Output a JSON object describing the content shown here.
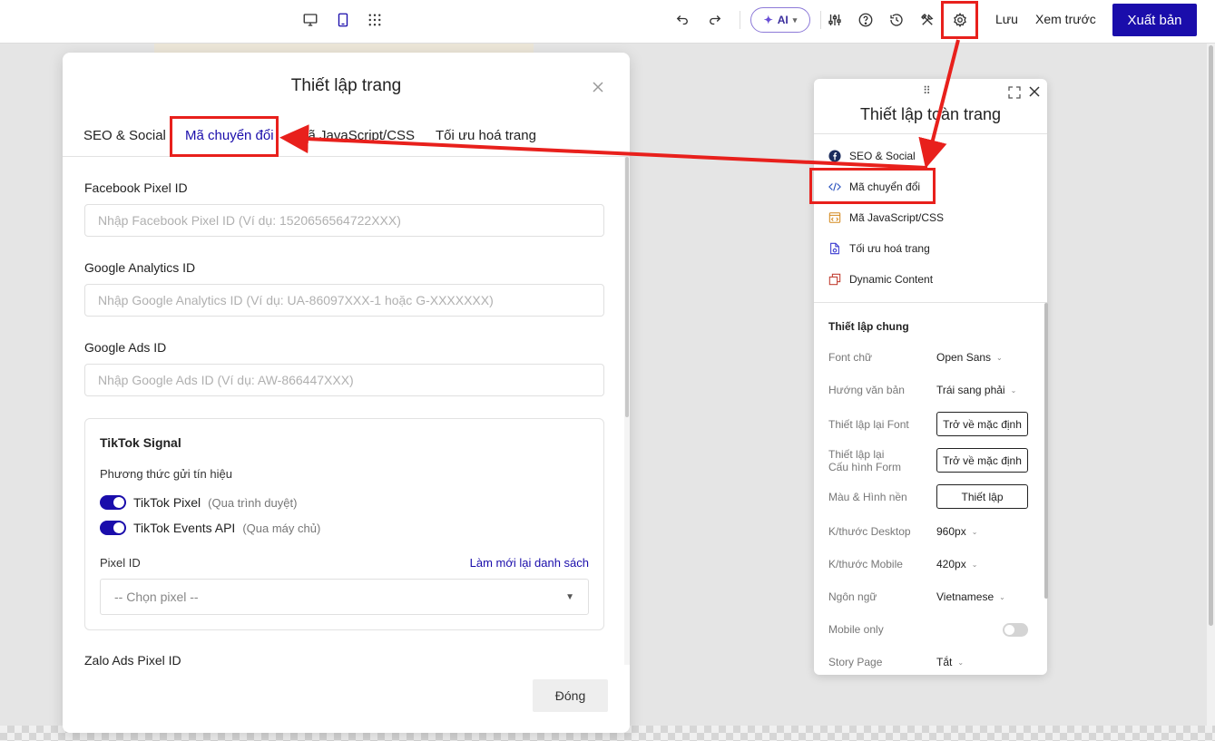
{
  "toolbar": {
    "ai_label": "AI",
    "save_label": "Lưu",
    "preview_label": "Xem trước",
    "publish_label": "Xuất bản"
  },
  "modal": {
    "title": "Thiết lập trang",
    "tabs": [
      {
        "label": "SEO & Social"
      },
      {
        "label": "Mã chuyển đổi"
      },
      {
        "label": "Mã JavaScript/CSS"
      },
      {
        "label": "Tối ưu hoá trang"
      }
    ],
    "active_tab": "Mã chuyển đổi",
    "fields": {
      "facebook": {
        "label": "Facebook Pixel ID",
        "value": "",
        "placeholder": "Nhập Facebook Pixel ID (Ví dụ: 1520656564722XXX)"
      },
      "analytics": {
        "label": "Google Analytics ID",
        "value": "",
        "placeholder": "Nhập Google Analytics ID (Ví dụ: UA-86097XXX-1 hoặc G-XXXXXXX)"
      },
      "ads": {
        "label": "Google Ads ID",
        "value": "",
        "placeholder": "Nhập Google Ads ID (Ví dụ: AW-866447XXX)"
      }
    },
    "tiktok": {
      "title": "TikTok Signal",
      "method_label": "Phương thức gửi tín hiệu",
      "pixel_toggle": {
        "label": "TikTok Pixel",
        "hint": "(Qua trình duyệt)",
        "on": true
      },
      "events_toggle": {
        "label": "TikTok Events API",
        "hint": "(Qua máy chủ)",
        "on": true
      },
      "pixel_id_label": "Pixel ID",
      "refresh_link": "Làm mới lại danh sách",
      "pixel_select_value": "-- Chọn pixel --"
    },
    "next_section_label": "Zalo Ads Pixel ID",
    "close_label": "Đóng"
  },
  "panel": {
    "title": "Thiết lập toàn trang",
    "menu": [
      {
        "label": "SEO & Social",
        "icon": "facebook-icon"
      },
      {
        "label": "Mã chuyển đổi",
        "icon": "code-icon"
      },
      {
        "label": "Mã JavaScript/CSS",
        "icon": "file-code-icon"
      },
      {
        "label": "Tối ưu hoá trang",
        "icon": "page-optimize-icon"
      },
      {
        "label": "Dynamic Content",
        "icon": "dynamic-content-icon"
      }
    ],
    "section_title": "Thiết lập chung",
    "settings": {
      "font": {
        "label": "Font chữ",
        "value": "Open Sans"
      },
      "direction": {
        "label": "Hướng văn bản",
        "value": "Trái sang phải"
      },
      "reset_font": {
        "label": "Thiết lập lại Font",
        "button": "Trở về mặc định"
      },
      "reset_form": {
        "label_line1": "Thiết lập lại",
        "label_line2": "Cấu hình Form",
        "button": "Trở về mặc định"
      },
      "background": {
        "label": "Màu & Hình nền",
        "button": "Thiết lập"
      },
      "desktop_size": {
        "label": "K/thước Desktop",
        "value": "960px"
      },
      "mobile_size": {
        "label": "K/thước Mobile",
        "value": "420px"
      },
      "language": {
        "label": "Ngôn ngữ",
        "value": "Vietnamese"
      },
      "mobile_only": {
        "label": "Mobile only",
        "on": false
      },
      "story_page": {
        "label": "Story Page",
        "value": "Tắt"
      }
    }
  },
  "colors": {
    "accent": "#1a0dab",
    "highlight": "#e8201c"
  }
}
